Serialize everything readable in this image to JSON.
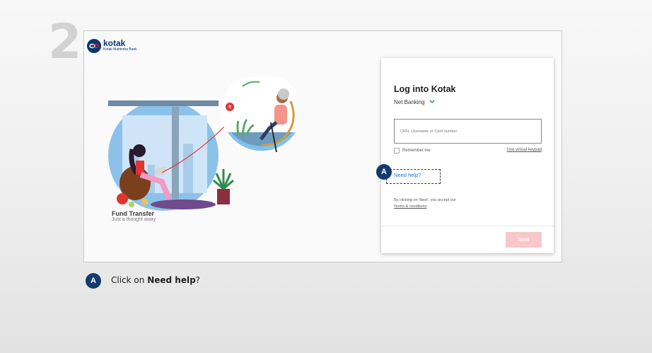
{
  "step": {
    "number": "2"
  },
  "brand": {
    "name": "kotak",
    "subtitle": "Kotak Mahindra Bank",
    "color": "#003874"
  },
  "illustration": {
    "title": "Fund Transfer",
    "subtitle": "Just a thought away"
  },
  "login": {
    "title": "Log into Kotak",
    "product": "Net Banking",
    "input_placeholder": "CRN, Username or Card number",
    "remember_label": "Remember me",
    "virtual_keypad_label": "Use virtual keypad",
    "need_help_label": "Need help?",
    "terms_prefix": "By clicking on 'Next', you accept our",
    "terms_link": "Terms & conditions",
    "next_label": "Next",
    "next_color": "#f9c7c9",
    "link_color": "#1e6fd0"
  },
  "callout": {
    "marker": "A",
    "instruction_prefix": "Click on",
    "instruction_bold": "Need help",
    "instruction_suffix": "?",
    "marker_color": "#143a6e"
  }
}
